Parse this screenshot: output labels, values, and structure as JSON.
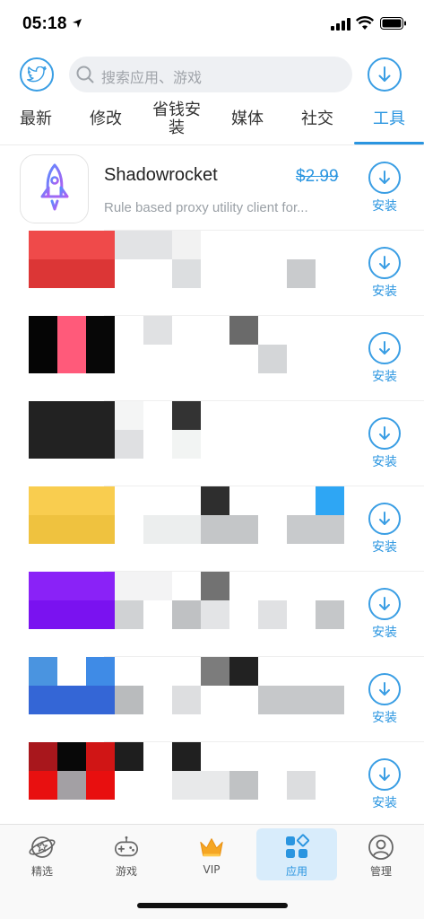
{
  "status_bar": {
    "time": "05:18"
  },
  "header": {
    "search_placeholder": "搜索应用、游戏"
  },
  "tabs": [
    {
      "label": "最新"
    },
    {
      "label": "修改"
    },
    {
      "label": "省钱安装"
    },
    {
      "label": "媒体"
    },
    {
      "label": "社交"
    },
    {
      "label": "工具",
      "active": true
    }
  ],
  "apps": [
    {
      "name": "Shadowrocket",
      "price": "$2.99",
      "description": "Rule based proxy utility client for...",
      "icon": "rocket-icon",
      "install_label": "安装"
    },
    {
      "obscured": true,
      "install_label": "安装"
    },
    {
      "obscured": true,
      "install_label": "安装"
    },
    {
      "obscured": true,
      "install_label": "安装"
    },
    {
      "obscured": true,
      "install_label": "安装"
    },
    {
      "obscured": true,
      "install_label": "安装"
    },
    {
      "obscured": true,
      "install_label": "安装"
    },
    {
      "obscured": true,
      "install_label": "安装"
    }
  ],
  "tab_bar": [
    {
      "label": "精选",
      "icon": "planet-star-icon"
    },
    {
      "label": "游戏",
      "icon": "gamepad-icon"
    },
    {
      "label": "VIP",
      "icon": "crown-icon"
    },
    {
      "label": "应用",
      "icon": "apps-grid-icon",
      "active": true
    },
    {
      "label": "管理",
      "icon": "user-icon"
    }
  ],
  "colors": {
    "accent": "#2a95e0",
    "tab_active_bg": "#d8ecfb"
  }
}
